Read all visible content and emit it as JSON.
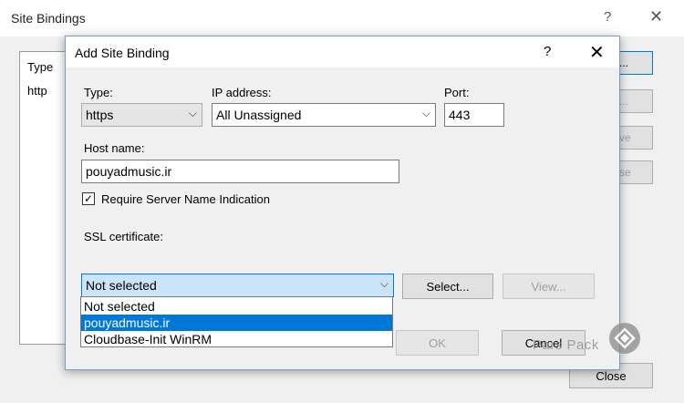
{
  "background_window": {
    "title": "Site Bindings",
    "help": "?",
    "close": "✕",
    "list": {
      "column_type": "Type",
      "rows": [
        {
          "type": "http"
        }
      ]
    },
    "buttons": {
      "add": "...",
      "edit": "...",
      "remove": "ve",
      "browse": "se",
      "close": "Close"
    }
  },
  "dialog": {
    "title": "Add Site Binding",
    "help": "?",
    "close": "✕",
    "type": {
      "label": "Type:",
      "value": "https"
    },
    "ip": {
      "label": "IP address:",
      "value": "All Unassigned"
    },
    "port": {
      "label": "Port:",
      "value": "443"
    },
    "host": {
      "label": "Host name:",
      "value": "pouyadmusic.ir"
    },
    "sni": {
      "label": "Require Server Name Indication",
      "checked": true,
      "check_glyph": "✓"
    },
    "ssl": {
      "label": "SSL certificate:",
      "value": "Not selected",
      "options": [
        "Not selected",
        "pouyadmusic.ir",
        "Cloudbase-Init WinRM"
      ],
      "highlighted_index": 1
    },
    "buttons": {
      "select": "Select...",
      "view": "View...",
      "ok": "OK",
      "cancel": "Cancel"
    },
    "arrow_glyph": "⌵"
  },
  "watermark": {
    "text": "Pars Pack"
  }
}
